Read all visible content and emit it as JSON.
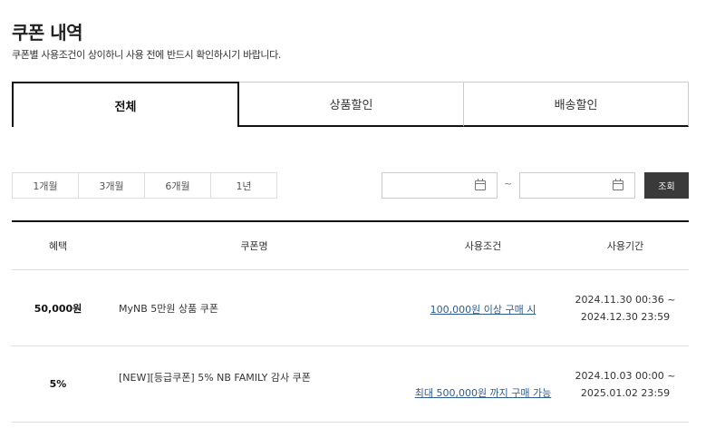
{
  "page": {
    "title": "쿠폰 내역",
    "description": "쿠폰별 사용조건이 상이하니 사용 전에 반드시 확인하시기 바랍니다."
  },
  "tabs": [
    {
      "label": "전체",
      "active": true
    },
    {
      "label": "상품할인",
      "active": false
    },
    {
      "label": "배송할인",
      "active": false
    }
  ],
  "filters": {
    "periods": [
      "1개월",
      "3개월",
      "6개월",
      "1년"
    ],
    "start_date": "",
    "end_date": "",
    "separator": "~",
    "search_label": "조회"
  },
  "table": {
    "headers": [
      "혜택",
      "쿠폰명",
      "사용조건",
      "사용기간"
    ],
    "rows": [
      {
        "benefit": "50,000원",
        "name": "MyNB 5만원 상품 쿠폰",
        "condition": "100,000원 이상 구매 시",
        "period_start": "2024.11.30 00:36 ~",
        "period_end": "2024.12.30 23:59"
      },
      {
        "benefit": "5%",
        "name": "[NEW][등급쿠폰] 5% NB FAMILY 감사 쿠폰",
        "condition": "최대 500,000원 까지 구매 가능",
        "period_start": "2024.10.03 00:00 ~",
        "period_end": "2025.01.02 23:59"
      }
    ]
  },
  "colors": {
    "accent": "#111111",
    "link": "#2f5c8a",
    "button_bg": "#3a3a3a"
  },
  "icons": [
    "calendar-icon",
    "calendar-icon"
  ]
}
